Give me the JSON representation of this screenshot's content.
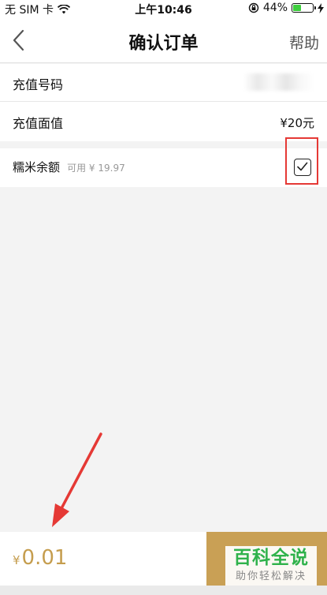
{
  "status_bar": {
    "carrier": "无 SIM 卡",
    "time": "上午10:46",
    "battery_text": "44%",
    "battery_level": 0.44,
    "icons": [
      "wifi-icon",
      "rotation-lock-icon",
      "battery-icon",
      "charging-icon"
    ]
  },
  "nav": {
    "title": "确认订单",
    "help": "帮助",
    "back_icon": "chevron-left-icon"
  },
  "order": {
    "phone_label": "充值号码",
    "face_value_label": "充值面值",
    "face_value": "¥20元"
  },
  "balance": {
    "label": "糯米余额",
    "available": "可用 ¥ 19.97",
    "checked": true
  },
  "footer": {
    "currency": "¥",
    "amount": "0.01"
  },
  "watermark": {
    "title": "百科全说",
    "subtitle": "助你轻松解决"
  },
  "colors": {
    "accent_gold": "#c9a055",
    "price_gold": "#c59d4e",
    "annotation_red": "#e53935",
    "watermark_green": "#2fb24b"
  }
}
